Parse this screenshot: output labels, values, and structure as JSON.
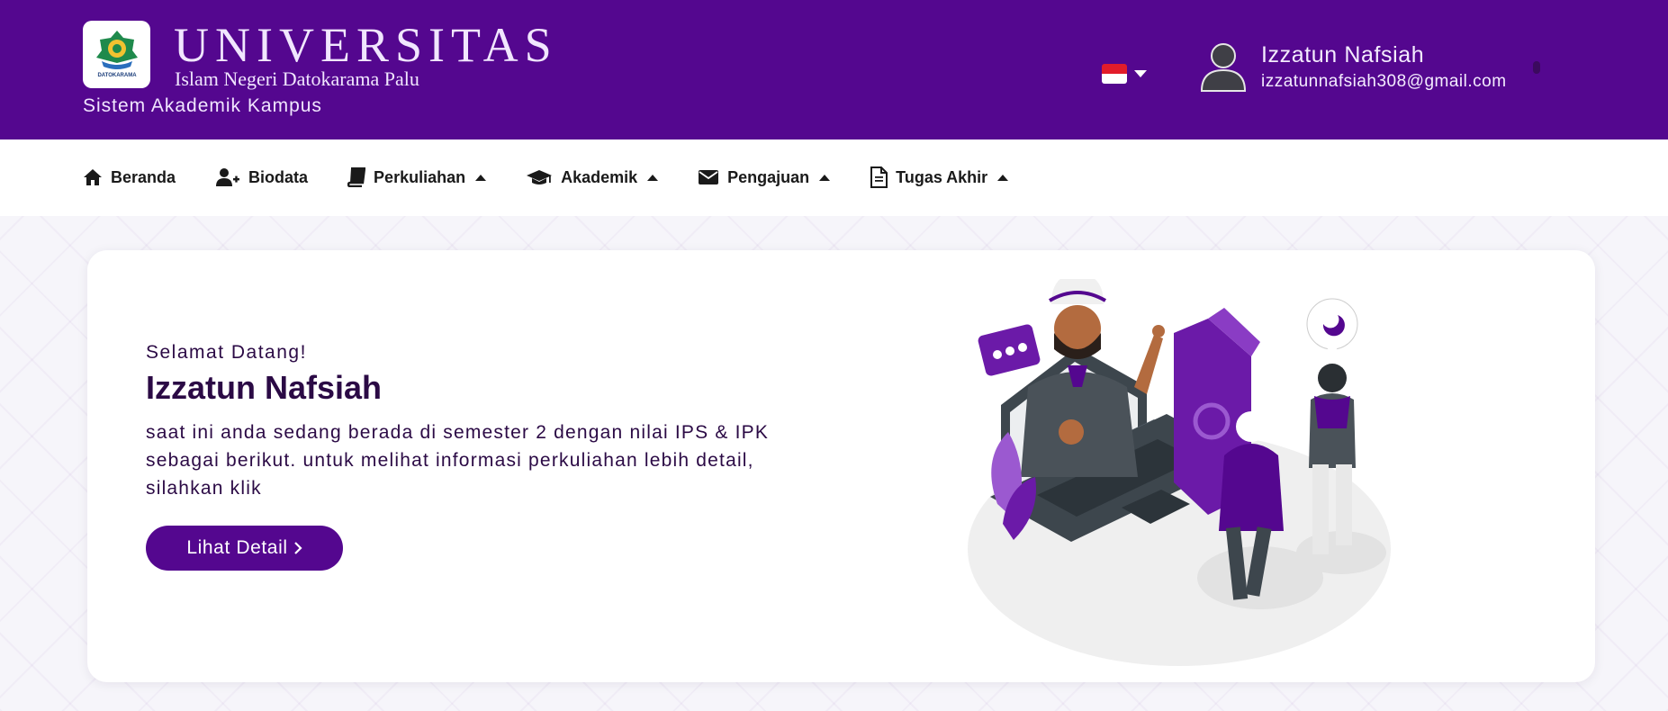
{
  "header": {
    "brand_title": "UNIVERSITAS",
    "brand_subtitle": "Islam Negeri Datokarama Palu",
    "app_name": "Sistem Akademik Kampus",
    "logo_text": "DATOKARAMA",
    "language": {
      "selected": "id-flag"
    },
    "user": {
      "name": "Izzatun Nafsiah",
      "email": "izzatunnafsiah308@gmail.com"
    }
  },
  "nav": {
    "items": [
      {
        "label": "Beranda",
        "icon": "home-icon",
        "dropdown": false
      },
      {
        "label": "Biodata",
        "icon": "user-plus-icon",
        "dropdown": false
      },
      {
        "label": "Perkuliahan",
        "icon": "book-icon",
        "dropdown": true
      },
      {
        "label": "Akademik",
        "icon": "graduation-cap-icon",
        "dropdown": true
      },
      {
        "label": "Pengajuan",
        "icon": "envelope-icon",
        "dropdown": true
      },
      {
        "label": "Tugas Akhir",
        "icon": "document-icon",
        "dropdown": true
      }
    ]
  },
  "hero": {
    "greeting": "Selamat Datang!",
    "name": "Izzatun Nafsiah",
    "description": "saat ini anda sedang berada di semester 2 dengan nilai IPS & IPK sebagai berikut. untuk melihat informasi perkuliahan lebih detail, silahkan klik",
    "button_label": "Lihat Detail",
    "button_icon": "chevron-right-icon"
  },
  "colors": {
    "primary": "#54078f",
    "text_dark": "#2b0a45",
    "accent_light": "#f1e6ff"
  }
}
